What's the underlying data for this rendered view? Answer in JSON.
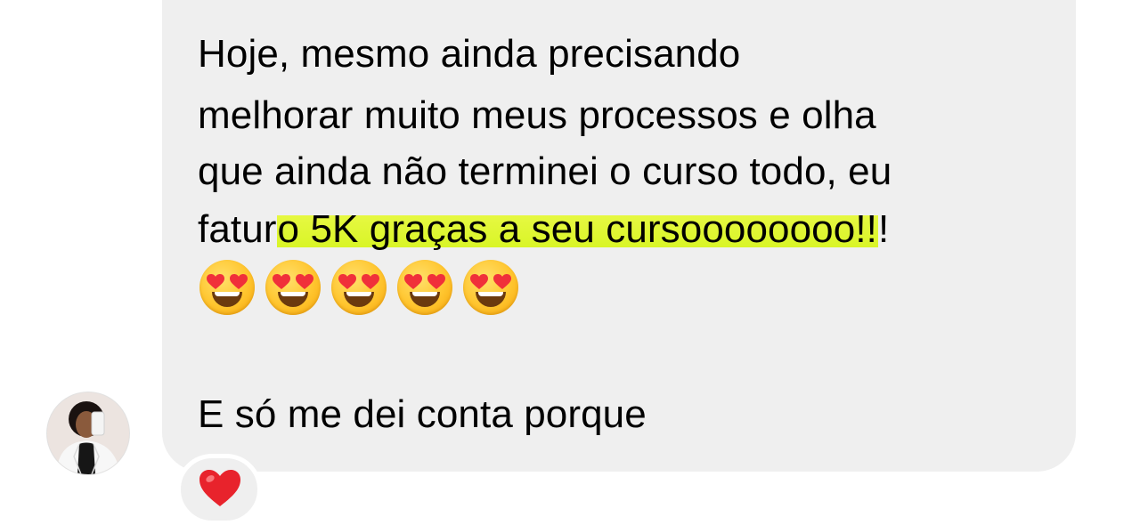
{
  "message": {
    "lines": [
      "Hoje, mesmo ainda precisando",
      "melhorar muito meus processos e olha",
      "que ainda não terminei o curso todo, eu"
    ],
    "line4_before": "fatur",
    "line4_highlight": "o 5K graças a seu cursoooooooo!!",
    "line4_after": "!",
    "emojis": [
      "smiling-face-with-heart-eyes",
      "smiling-face-with-heart-eyes",
      "smiling-face-with-heart-eyes",
      "smiling-face-with-heart-eyes",
      "smiling-face-with-heart-eyes"
    ],
    "last_line": "E só me dei conta porque"
  },
  "reaction": {
    "icon": "red-heart"
  },
  "colors": {
    "bubble": "#efefef",
    "highlight": "#d9f527",
    "heart": "#e8232c"
  }
}
